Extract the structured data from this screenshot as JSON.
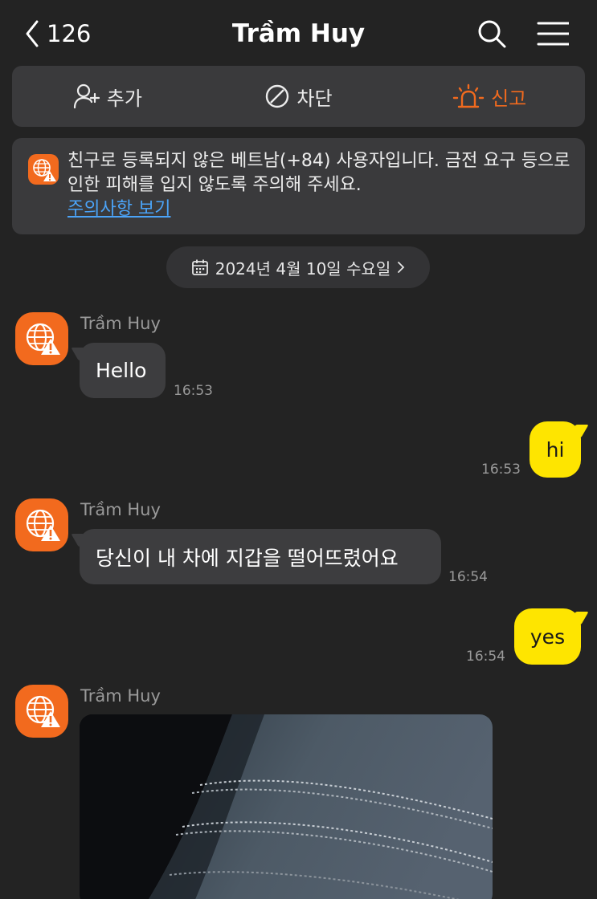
{
  "header": {
    "back_count": "126",
    "title": "Trầm Huy"
  },
  "actions": {
    "add": "추가",
    "block": "차단",
    "report": "신고"
  },
  "notice": {
    "text": "친구로 등록되지 않은 베트남(+84) 사용자입니다. 금전 요구 등으로 인한 피해를 입지 않도록 주의해 주세요.",
    "link": "주의사항 보기"
  },
  "date_divider": "2024년 4월 10일 수요일",
  "messages": [
    {
      "direction": "in",
      "sender": "Trầm Huy",
      "text": "Hello",
      "time": "16:53"
    },
    {
      "direction": "out",
      "text": "hi",
      "time": "16:53"
    },
    {
      "direction": "in",
      "sender": "Trầm Huy",
      "text": "당신이 내 차에 지갑을 떨어뜨렸어요",
      "time": "16:54"
    },
    {
      "direction": "out",
      "text": "yes",
      "time": "16:54"
    },
    {
      "direction": "in",
      "sender": "Trầm Huy",
      "type": "image"
    }
  ],
  "colors": {
    "background": "#232323",
    "panel": "#3a3a3c",
    "accent_orange": "#f26a1e",
    "outgoing_bubble": "#fee500",
    "incoming_bubble": "#3d3d3f",
    "link": "#4ba3f7"
  },
  "icons": {
    "back": "chevron-left-icon",
    "search": "search-icon",
    "menu": "hamburger-menu-icon",
    "add_friend": "person-add-icon",
    "block": "block-icon",
    "report": "siren-icon",
    "warning_avatar": "globe-warning-icon",
    "calendar": "calendar-icon"
  }
}
